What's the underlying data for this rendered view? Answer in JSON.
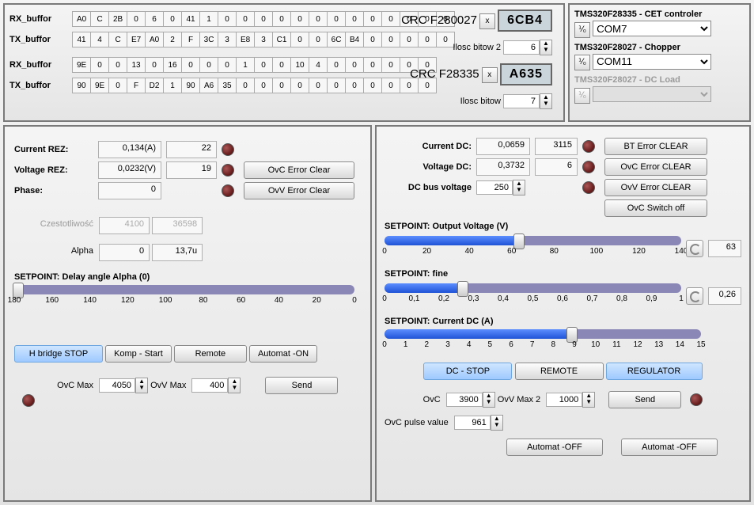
{
  "top": {
    "rx1_label": "RX_buffor",
    "tx1_label": "TX_buffor",
    "rx2_label": "RX_buffor",
    "tx2_label": "TX_buffor",
    "rx1": [
      "A0",
      "C",
      "2B",
      "0",
      "6",
      "0",
      "41",
      "1",
      "0",
      "0",
      "0",
      "0",
      "0",
      "0",
      "0",
      "0",
      "0",
      "0",
      "0",
      "0",
      "0"
    ],
    "tx1": [
      "41",
      "4",
      "C",
      "E7",
      "A0",
      "2",
      "F",
      "3C",
      "3",
      "E8",
      "3",
      "C1",
      "0",
      "0",
      "6C",
      "B4",
      "0",
      "0",
      "0",
      "0",
      "0"
    ],
    "rx2": [
      "9E",
      "0",
      "0",
      "13",
      "0",
      "16",
      "0",
      "0",
      "0",
      "1",
      "0",
      "0",
      "10",
      "4",
      "0",
      "0",
      "0",
      "0",
      "0",
      "0"
    ],
    "tx2": [
      "90",
      "9E",
      "0",
      "F",
      "D2",
      "1",
      "90",
      "A6",
      "35",
      "0",
      "0",
      "0",
      "0",
      "0",
      "0",
      "0",
      "0",
      "0",
      "0",
      "0"
    ],
    "crc1_label": "CRC F280027",
    "crc1": "6CB4",
    "crc2_label": "CRC F28335",
    "crc2": "A635",
    "ilosc2_label": "Ilosc bitow 2",
    "ilosc2": "6",
    "ilosc_label": "Ilosc bitow",
    "ilosc": "7"
  },
  "side": {
    "p1_title": "TMS320F28335 - CET controler",
    "p1_sel": "COM7",
    "p2_title": "TMS320F28027 - Chopper",
    "p2_sel": "COM11",
    "p3_title": "TMS320F28027 - DC Load",
    "p3_sel": "",
    "io": "I/O"
  },
  "left": {
    "currez_l": "Current REZ:",
    "currez_v": "0,134(A)",
    "currez_r": "22",
    "volrez_l": "Voltage REZ:",
    "volrez_v": "0,0232(V)",
    "volrez_r": "19",
    "phase_l": "Phase:",
    "phase_v": "0",
    "phase_r": "",
    "ovc_clear": "OvC Error Clear",
    "ovv_clear": "OvV Error Clear",
    "czest_l": "Czestotliwość",
    "czest_a": "4100",
    "czest_b": "36598",
    "alpha_l": "Alpha",
    "alpha_a": "0",
    "alpha_b": "13,7u",
    "sp_title": "SETPOINT: Delay angle Alpha (0)",
    "sp_ticks": [
      "180",
      "160",
      "140",
      "120",
      "100",
      "80",
      "60",
      "40",
      "20",
      "0"
    ],
    "hb": "H bridge STOP",
    "komp": "Komp - Start",
    "remote": "Remote",
    "auto": "Automat -ON",
    "ovcmax_l": "OvC Max",
    "ovcmax": "4050",
    "ovvmax_l": "OvV Max",
    "ovvmax": "400",
    "send": "Send"
  },
  "right": {
    "cdc_l": "Current DC:",
    "cdc_a": "0,0659",
    "cdc_b": "3115",
    "vdc_l": "Voltage DC:",
    "vdc_a": "0,3732",
    "vdc_b": "6",
    "bus_l": "DC bus voltage",
    "bus_v": "250",
    "bt": "BT Error CLEAR",
    "ovc": "OvC Error CLEAR",
    "ovv": "OvV Error CLEAR",
    "ovcsw": "OvC  Switch off",
    "s1_title": "SETPOINT: Output Voltage  (V)",
    "s1_ticks": [
      "0",
      "20",
      "40",
      "60",
      "80",
      "100",
      "120",
      "140"
    ],
    "s1_val": "63",
    "s1_pct": 45,
    "s2_title": "SETPOINT: fine",
    "s2_ticks": [
      "0",
      "0,1",
      "0,2",
      "0,3",
      "0,4",
      "0,5",
      "0,6",
      "0,7",
      "0,8",
      "0,9",
      "1"
    ],
    "s2_val": "0,26",
    "s2_pct": 26,
    "s3_title": "SETPOINT: Current DC (A)",
    "s3_ticks": [
      "0",
      "1",
      "2",
      "3",
      "4",
      "5",
      "6",
      "7",
      "8",
      "9",
      "10",
      "11",
      "12",
      "13",
      "14",
      "15"
    ],
    "s3_pct": 59,
    "dcstop": "DC - STOP",
    "remote": "REMOTE",
    "reg": "REGULATOR",
    "ovc2_l": "OvC",
    "ovc2": "3900",
    "ovvmax2_l": "OvV Max 2",
    "ovvmax2": "1000",
    "send": "Send",
    "pulse_l": "OvC pulse value",
    "pulse": "961",
    "auto1": "Automat -OFF",
    "auto2": "Automat -OFF"
  }
}
